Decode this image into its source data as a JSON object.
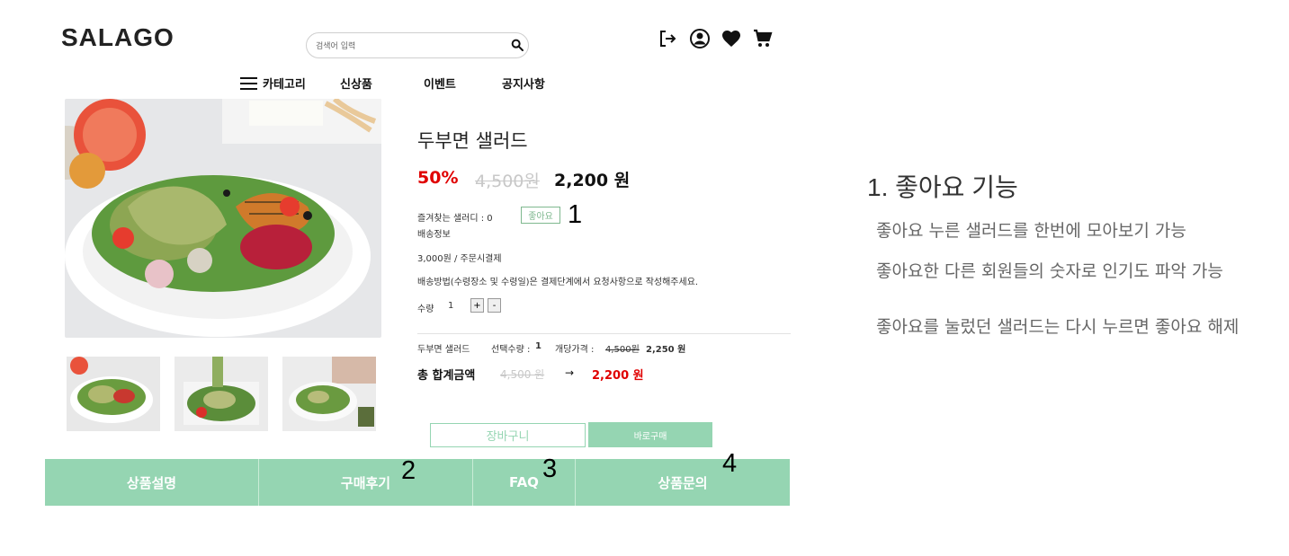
{
  "colors": {
    "brand": "#95d5b2",
    "sale": "#e00000",
    "muted": "#c8c8c8",
    "like_border": "#7fb88f"
  },
  "header": {
    "logo": "SALAGO",
    "search": {
      "placeholder": "검색어 입력",
      "value": ""
    },
    "icons": [
      "logout-icon",
      "user-account-icon",
      "heart-icon",
      "cart-icon"
    ]
  },
  "nav": {
    "menu_icon": "hamburger-icon",
    "items": [
      "카테고리",
      "신상품",
      "이벤트",
      "공지사항"
    ]
  },
  "product": {
    "title": "두부면 샐러드",
    "discount": "50%",
    "original_price": "4,500원",
    "price": "2,200 원",
    "favorite_label": "즐겨찾는 샐러디 : 0",
    "like_button": "좋아요",
    "shipping_title": "배송정보",
    "shipping_fee": "3,000원 / 주문시결제",
    "shipping_note": "배송방법(수령장소 및 수령일)은 결제단계에서 요청사항으로 작성해주세요.",
    "quantity_label": "수량",
    "quantity_value": "1",
    "plus": "+",
    "minus": "-"
  },
  "selection": {
    "name": "두부면 샐러드",
    "qty_label": "선택수량 :",
    "qty_value": "1",
    "unit_label": "개당가격 :",
    "unit_orig": "4,500원",
    "unit_price": "2,250 원"
  },
  "total": {
    "label": "총 합계금액",
    "orig": "4,500 원",
    "arrow": "→",
    "price": "2,200 원"
  },
  "buttons": {
    "cart": "장바구니",
    "buy": "바로구매"
  },
  "tabs": [
    "상품설명",
    "구매후기",
    "FAQ",
    "상품문의"
  ],
  "annotations": [
    "1",
    "2",
    "3",
    "4"
  ],
  "right_panel": {
    "title": "1. 좋아요 기능",
    "lines": [
      "좋아요 누른 샐러드를 한번에 모아보기 가능",
      "좋아요한 다른 회원들의 숫자로 인기도 파악 가능",
      "좋아요를 눌렀던 샐러드는 다시 누르면 좋아요 해제"
    ]
  }
}
